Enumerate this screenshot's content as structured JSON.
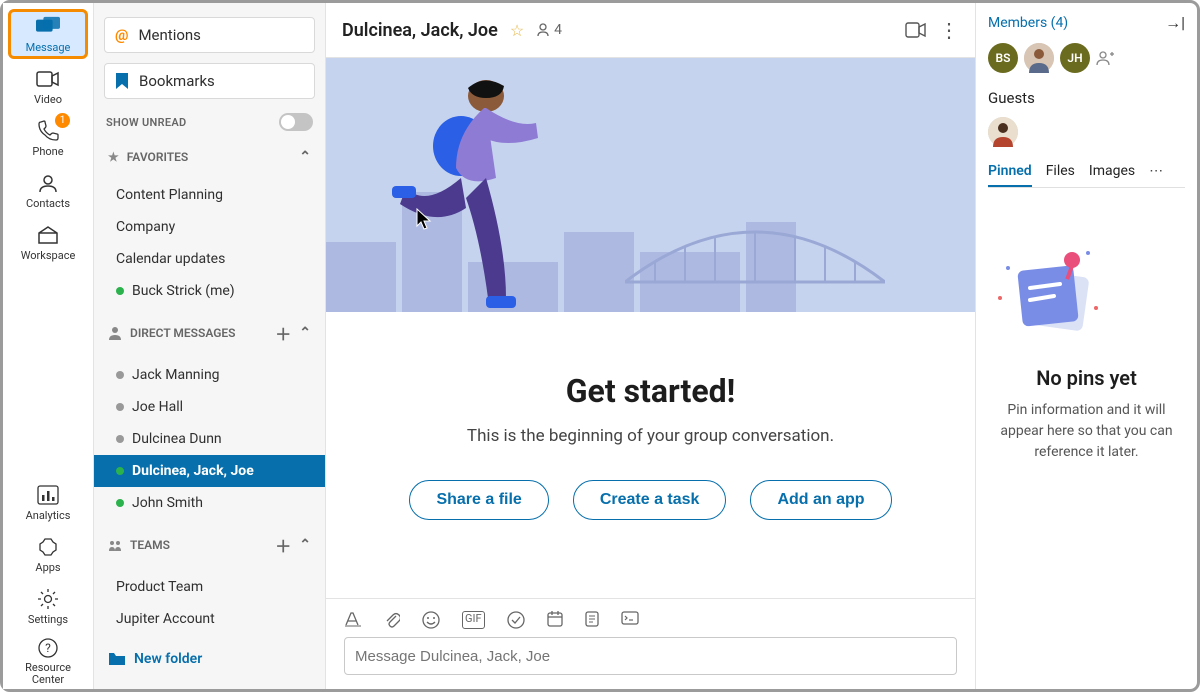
{
  "rail": {
    "items": [
      {
        "key": "message",
        "label": "Message"
      },
      {
        "key": "video",
        "label": "Video"
      },
      {
        "key": "phone",
        "label": "Phone",
        "badge": "1"
      },
      {
        "key": "contacts",
        "label": "Contacts"
      },
      {
        "key": "workspace",
        "label": "Workspace"
      },
      {
        "key": "analytics",
        "label": "Analytics"
      },
      {
        "key": "apps",
        "label": "Apps"
      },
      {
        "key": "settings",
        "label": "Settings"
      },
      {
        "key": "resource",
        "label": "Resource Center"
      }
    ],
    "active": "message"
  },
  "convcol": {
    "mentions": "Mentions",
    "bookmarks": "Bookmarks",
    "showUnread": "SHOW UNREAD",
    "favorites": {
      "title": "FAVORITES",
      "items": [
        {
          "label": "Content Planning",
          "status": "none"
        },
        {
          "label": "Company",
          "status": "none"
        },
        {
          "label": "Calendar updates",
          "status": "none"
        },
        {
          "label": "Buck Strick (me)",
          "status": "online"
        }
      ]
    },
    "dm": {
      "title": "DIRECT MESSAGES",
      "items": [
        {
          "label": "Jack Manning",
          "status": "offline"
        },
        {
          "label": "Joe Hall",
          "status": "offline"
        },
        {
          "label": "Dulcinea Dunn",
          "status": "offline"
        },
        {
          "label": "Dulcinea, Jack, Joe",
          "status": "online",
          "selected": true
        },
        {
          "label": "John Smith",
          "status": "online"
        }
      ]
    },
    "teams": {
      "title": "TEAMS",
      "items": [
        {
          "label": "Product Team"
        },
        {
          "label": "Jupiter Account"
        }
      ]
    },
    "newFolder": "New folder"
  },
  "chat": {
    "title": "Dulcinea, Jack, Joe",
    "participants": "4",
    "hero_alt": "illustration",
    "getStarted": {
      "title": "Get started!",
      "subtitle": "This is the beginning of your group conversation.",
      "buttons": [
        "Share a file",
        "Create a task",
        "Add an app"
      ]
    },
    "composer": {
      "placeholder": "Message Dulcinea, Jack, Joe",
      "icons": [
        "font-icon",
        "attach-icon",
        "emoji-icon",
        "gif-icon",
        "task-icon",
        "calendar-icon",
        "note-icon",
        "code-icon"
      ]
    }
  },
  "rpanel": {
    "membersLink": "Members (4)",
    "avatars": [
      "BS",
      "",
      "JH"
    ],
    "guests": "Guests",
    "tabs": [
      "Pinned",
      "Files",
      "Images"
    ],
    "activeTab": 0,
    "empty": {
      "title": "No pins yet",
      "sub": "Pin information and it will appear here so that you can reference it later."
    }
  }
}
